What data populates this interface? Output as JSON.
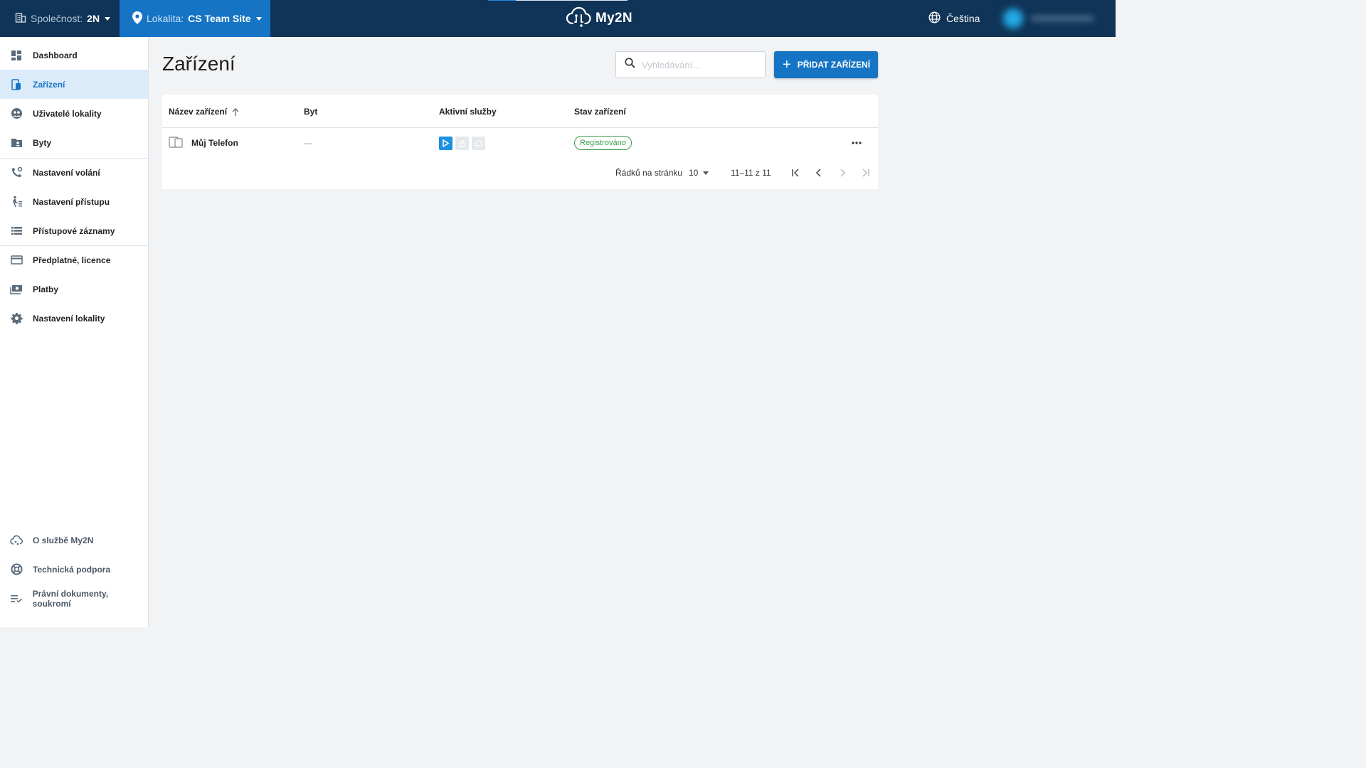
{
  "colors": {
    "topbar": "#0f3457",
    "accent": "#1574c4",
    "active_bg": "#dcebfa",
    "status_green": "#3a9a4f"
  },
  "topbar": {
    "company_label": "Společnost:",
    "company_value": "2N",
    "location_label": "Lokalita:",
    "location_value": "CS Team Site",
    "brand": "My2N",
    "language": "Čeština"
  },
  "sidebar": {
    "items": [
      {
        "label": "Dashboard",
        "icon": "dashboard-icon"
      },
      {
        "label": "Zařízení",
        "icon": "devices-icon",
        "active": true
      },
      {
        "label": "Uživatelé lokality",
        "icon": "users-icon"
      },
      {
        "label": "Byty",
        "icon": "apartments-icon"
      },
      {
        "label": "Nastavení volání",
        "icon": "phone-settings-icon"
      },
      {
        "label": "Nastavení přístupu",
        "icon": "access-icon"
      },
      {
        "label": "Přístupové záznamy",
        "icon": "access-log-icon"
      },
      {
        "label": "Předplatné, licence",
        "icon": "credit-card-icon"
      },
      {
        "label": "Platby",
        "icon": "payments-icon"
      },
      {
        "label": "Nastavení lokality",
        "icon": "gear-icon"
      }
    ],
    "footer": [
      {
        "label": "O službě My2N",
        "icon": "cloud-icon"
      },
      {
        "label": "Technická podpora",
        "icon": "lifebuoy-icon"
      },
      {
        "label": "Právní dokumenty, soukromí",
        "icon": "checklist-icon"
      }
    ]
  },
  "main": {
    "title": "Zařízení",
    "search_placeholder": "Vyhledávání...",
    "add_button": "PŘIDAT ZAŘÍZENÍ",
    "table": {
      "columns": [
        "Název zařízení",
        "Byt",
        "Aktivní služby",
        "Stav zařízení"
      ],
      "sort": {
        "column": "Název zařízení",
        "direction": "ascending"
      },
      "rows": [
        {
          "name": "Můj Telefon",
          "apartment": "—",
          "services": [
            "active",
            "inactive",
            "inactive"
          ],
          "status": "Registrováno"
        }
      ]
    },
    "pagination": {
      "rows_per_page_label": "Řádků na stránku",
      "rows_per_page": "10",
      "range": "11–11 z 11"
    }
  }
}
